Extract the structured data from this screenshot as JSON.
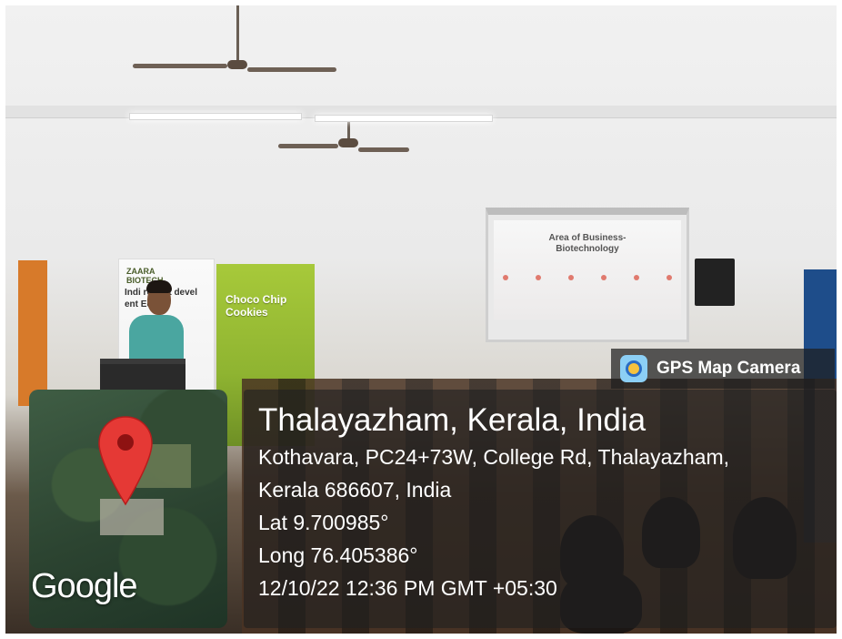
{
  "image": {
    "slide_title_line1": "Area of Business-",
    "slide_title_line2": "Biotechnology",
    "banner_left_logo_line1": "ZAARA",
    "banner_left_logo_line2": "BIOTECH",
    "banner_left_tagline": "Indi roduct devel ent Edu nt",
    "banner_right_title": "Choco Chip Cookies"
  },
  "gps_badge": {
    "icon": "gps-map-camera-icon",
    "label": "GPS Map Camera"
  },
  "map": {
    "provider_label": "Google",
    "pin_color": "#e53935"
  },
  "location": {
    "place": "Thalayazham, Kerala, India",
    "address_line1": "Kothavara, PC24+73W, College Rd, Thalayazham,",
    "address_line2": "Kerala 686607, India",
    "latitude": "Lat 9.700985°",
    "longitude": "Long 76.405386°",
    "timestamp": "12/10/22 12:36 PM GMT +05:30"
  }
}
